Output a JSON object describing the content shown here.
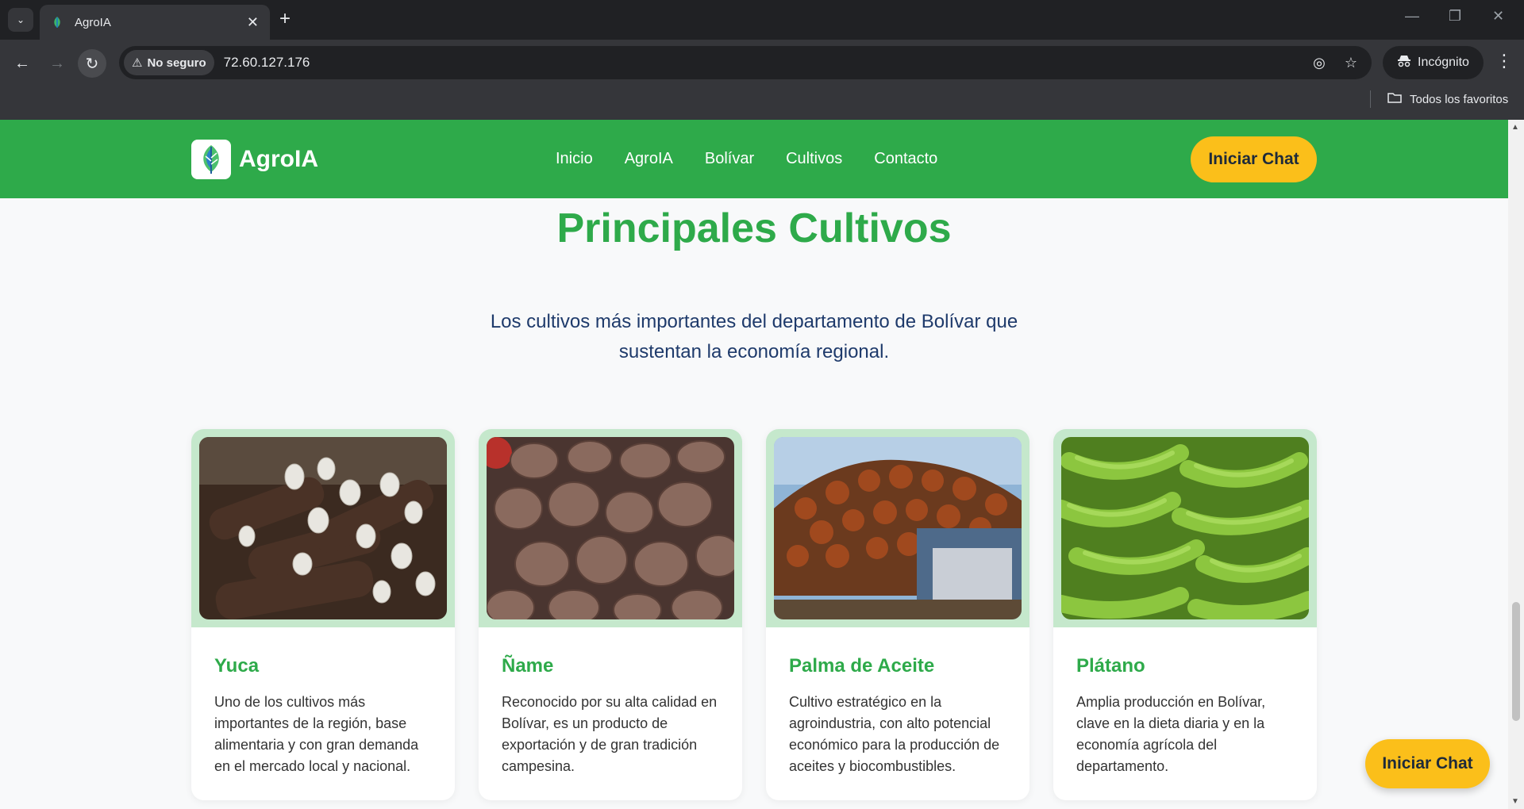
{
  "browser": {
    "tab_title": "AgroIA",
    "security_label": "No seguro",
    "url": "72.60.127.176",
    "profile_label": "Incógnito",
    "bookmarks_label": "Todos los favoritos"
  },
  "header": {
    "brand": "AgroIA",
    "nav": [
      "Inicio",
      "AgroIA",
      "Bolívar",
      "Cultivos",
      "Contacto"
    ],
    "cta": "Iniciar Chat"
  },
  "section": {
    "title": "Principales Cultivos",
    "subtitle": "Los cultivos más importantes del departamento de Bolívar que sustentan la economía regional."
  },
  "cards": [
    {
      "title": "Yuca",
      "text": "Uno de los cultivos más importantes de la región, base alimentaria y con gran demanda en el mercado local y nacional."
    },
    {
      "title": "Ñame",
      "text": "Reconocido por su alta calidad en Bolívar, es un producto de exportación y de gran tradición campesina."
    },
    {
      "title": "Palma de Aceite",
      "text": "Cultivo estratégico en la agroindustria, con alto potencial económico para la producción de aceites y biocombustibles."
    },
    {
      "title": "Plátano",
      "text": "Amplia producción en Bolívar, clave en la dieta diaria y en la economía agrícola del departamento."
    }
  ],
  "floating_cta": "Iniciar Chat",
  "colors": {
    "brand_green": "#2eaa4a",
    "accent_yellow": "#fbbf1a",
    "subtitle_blue": "#1e3a6b",
    "card_media_bg": "#c5e8cc"
  }
}
